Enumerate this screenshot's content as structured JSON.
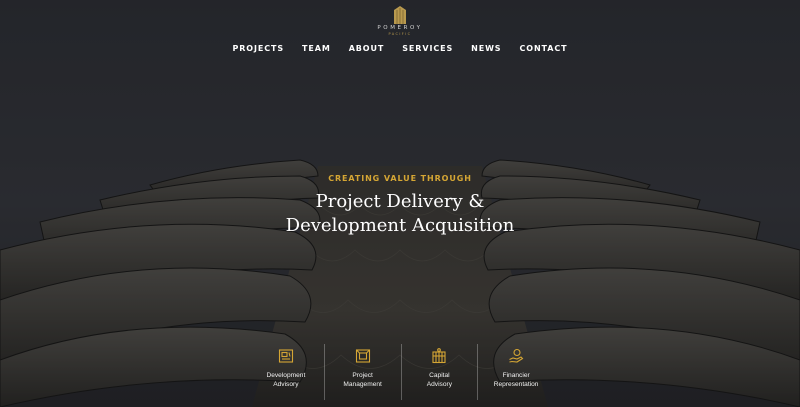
{
  "brand": {
    "name": "POMEROY",
    "sub": "PACIFIC",
    "colors": {
      "gold": "#d5a634",
      "background": "#34363d",
      "text": "#ffffff"
    }
  },
  "nav": {
    "items": [
      {
        "label": "PROJECTS"
      },
      {
        "label": "TEAM"
      },
      {
        "label": "ABOUT"
      },
      {
        "label": "SERVICES"
      },
      {
        "label": "NEWS"
      },
      {
        "label": "CONTACT"
      }
    ]
  },
  "hero": {
    "tagline": "CREATING VALUE THROUGH",
    "headline_line1": "Project Delivery &",
    "headline_line2": "Development Acquisition"
  },
  "services": [
    {
      "line1": "Development",
      "line2": "Advisory",
      "icon": "blueprint-icon"
    },
    {
      "line1": "Project",
      "line2": "Management",
      "icon": "frame-icon"
    },
    {
      "line1": "Capital",
      "line2": "Advisory",
      "icon": "building-icon"
    },
    {
      "line1": "Financier",
      "line2": "Representation",
      "icon": "hand-coin-icon"
    }
  ]
}
